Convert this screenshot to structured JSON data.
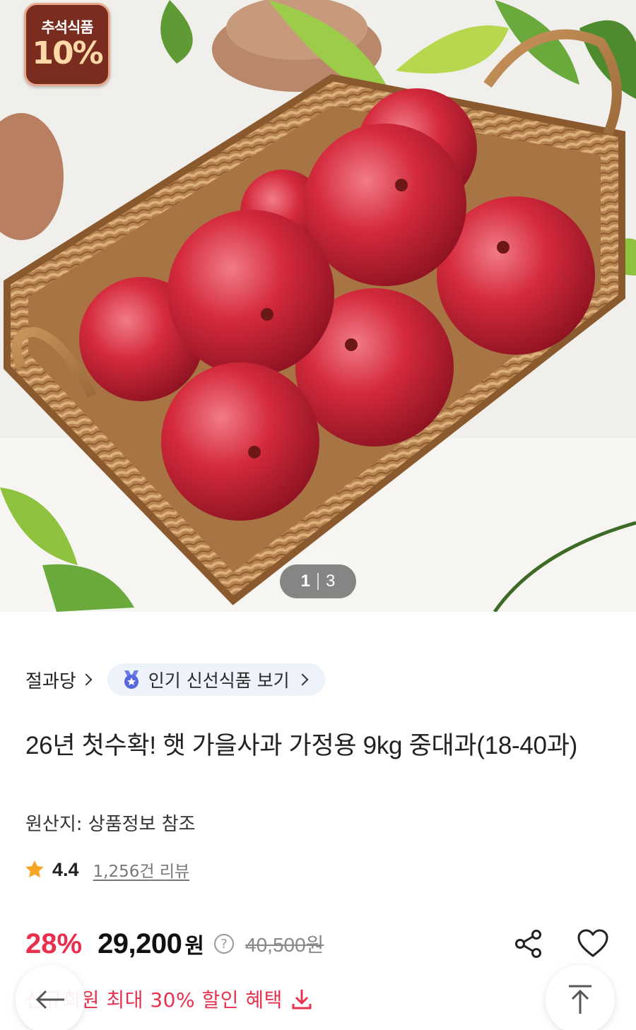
{
  "hero": {
    "image_alt": "",
    "promo_badge": {
      "label": "추석식품",
      "percent": "10%"
    },
    "pager": {
      "current": "1",
      "total": "3"
    }
  },
  "seller": {
    "name": "절과당",
    "icon": "chevron-right-icon"
  },
  "fresh_link": {
    "label": "인기 신선식품 보기",
    "icon": "medal-icon"
  },
  "product": {
    "title": "26년 첫수확! 햇 가을사과 가정용 9kg 중대과(18-40과)",
    "origin": "원산지: 상품정보 참조"
  },
  "rating": {
    "score": "4.4",
    "reviews": "1,256건 리뷰",
    "icon": "star-icon",
    "color": "#f5a623"
  },
  "price": {
    "discount": "28%",
    "sale": "29,200",
    "unit": "원",
    "help": "?",
    "original": "40,500원",
    "discount_color": "#ea2f4e"
  },
  "actions": {
    "share_icon": "share-icon",
    "wishlist_icon": "heart-icon"
  },
  "coupon": {
    "text": "신규회원 최대 30% 할인 혜택",
    "icon": "download-icon",
    "color": "#e5334f"
  },
  "floating": {
    "back_icon": "arrow-left-icon",
    "top_icon": "scroll-top-icon"
  }
}
